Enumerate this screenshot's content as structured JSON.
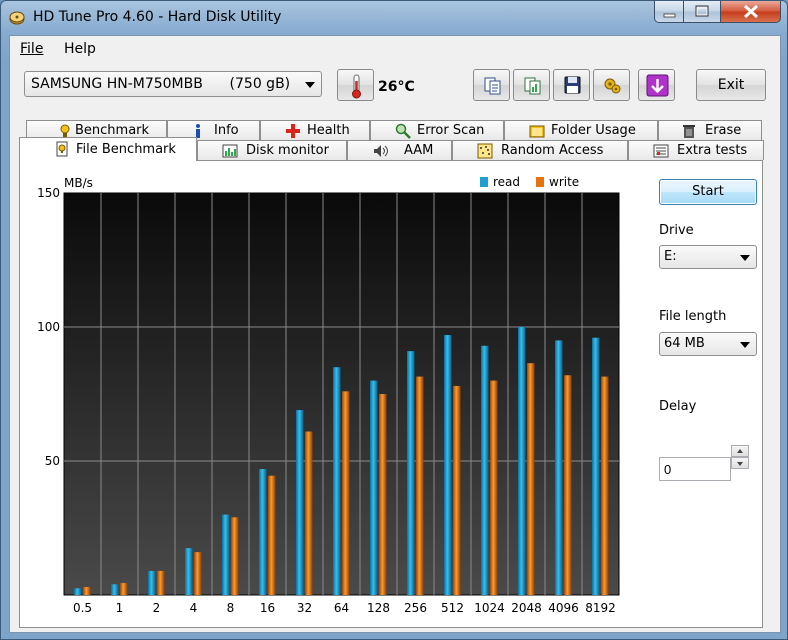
{
  "window": {
    "title": "HD Tune Pro 4.60 - Hard Disk Utility"
  },
  "menu": {
    "file": "File",
    "help": "Help"
  },
  "toolbar": {
    "drive": "SAMSUNG HN-M750MBB      (750 gB)",
    "temperature": "26°C",
    "exit_label": "Exit",
    "icons": [
      "thermometer-icon",
      "copy-info-icon",
      "copy-screenshot-icon",
      "save-icon",
      "options-icon",
      "download-icon"
    ]
  },
  "tabs_row1": [
    {
      "label": "Benchmark",
      "icon": "benchmark-icon"
    },
    {
      "label": "Info",
      "icon": "info-icon"
    },
    {
      "label": "Health",
      "icon": "health-icon"
    },
    {
      "label": "Error Scan",
      "icon": "error-scan-icon"
    },
    {
      "label": "Folder Usage",
      "icon": "folder-usage-icon"
    },
    {
      "label": "Erase",
      "icon": "erase-icon"
    }
  ],
  "tabs_row2": [
    {
      "label": "File Benchmark",
      "icon": "file-benchmark-icon",
      "active": true
    },
    {
      "label": "Disk monitor",
      "icon": "disk-monitor-icon"
    },
    {
      "label": "AAM",
      "icon": "aam-icon"
    },
    {
      "label": "Random Access",
      "icon": "random-access-icon"
    },
    {
      "label": "Extra tests",
      "icon": "extra-tests-icon"
    }
  ],
  "controls": {
    "start_label": "Start",
    "drive_label": "Drive",
    "drive_value": "E:",
    "file_length_label": "File length",
    "file_length_value": "64 MB",
    "delay_label": "Delay",
    "delay_value": "0"
  },
  "colors": {
    "read": "#1d9fd0",
    "write": "#e8720c"
  },
  "chart_data": {
    "type": "bar",
    "ylabel": "MB/s",
    "ylim": [
      0,
      150
    ],
    "yticks": [
      "150",
      "100",
      "50"
    ],
    "categories": [
      "0.5",
      "1",
      "2",
      "4",
      "8",
      "16",
      "32",
      "64",
      "128",
      "256",
      "512",
      "1024",
      "2048",
      "4096",
      "8192"
    ],
    "series": [
      {
        "name": "read",
        "values": [
          2.5,
          4,
          9,
          17.5,
          30,
          47,
          69,
          85,
          80,
          91,
          97,
          93,
          100,
          95,
          96
        ]
      },
      {
        "name": "write",
        "values": [
          3,
          4.5,
          9,
          16,
          29,
          44.5,
          61,
          76,
          75,
          81.5,
          78,
          80,
          86.5,
          82,
          81.5
        ]
      }
    ],
    "legend": "top-right",
    "grid": true
  }
}
